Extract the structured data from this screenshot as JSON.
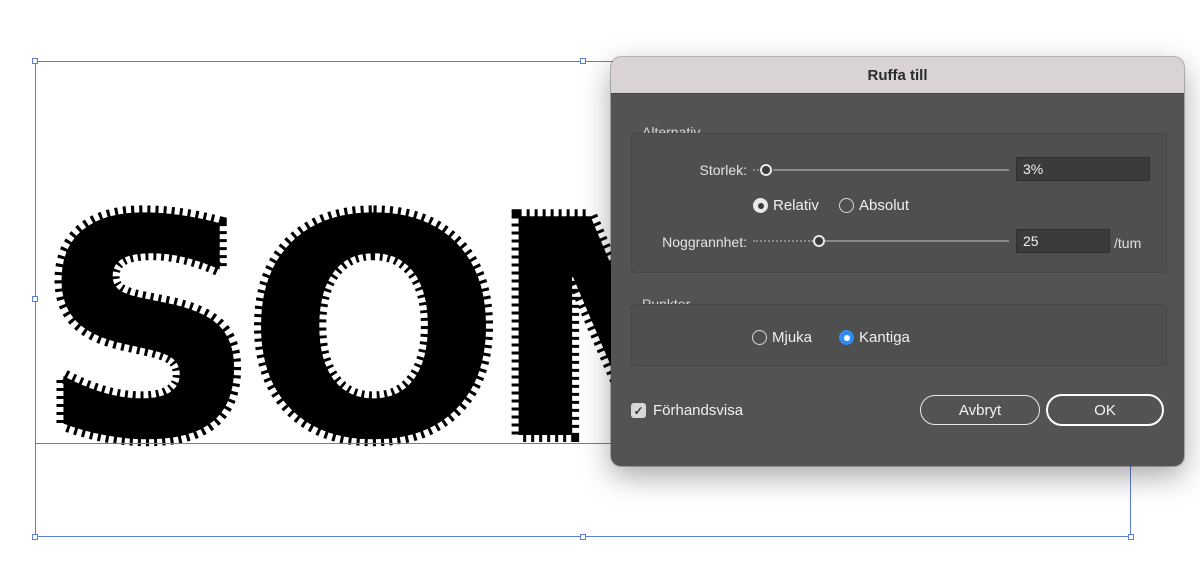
{
  "artwork": {
    "text": "SOM"
  },
  "dialog": {
    "title": "Ruffa till",
    "alternativ": {
      "label": "Alternativ",
      "storlek_label": "Storlek:",
      "storlek_value": "3%",
      "storlek_slider_fraction": 0.02,
      "mode_options": [
        {
          "label": "Relativ",
          "selected": true
        },
        {
          "label": "Absolut",
          "selected": false
        }
      ],
      "noggrannhet_label": "Noggrannhet:",
      "noggrannhet_value": "25",
      "noggrannhet_unit": "/tum",
      "noggrannhet_slider_fraction": 0.25
    },
    "punkter": {
      "label": "Punkter",
      "options": [
        {
          "label": "Mjuka",
          "selected": false
        },
        {
          "label": "Kantiga",
          "selected": true
        }
      ]
    },
    "preview": {
      "label": "Förhandsvisa",
      "checked": true
    },
    "buttons": {
      "cancel": "Avbryt",
      "ok": "OK"
    }
  },
  "colors": {
    "dialog_bg": "#535353",
    "titlebar_bg": "#d9d4d3",
    "selection_blue": "#5b7fd6",
    "radio_accent": "#2f8cf5"
  }
}
